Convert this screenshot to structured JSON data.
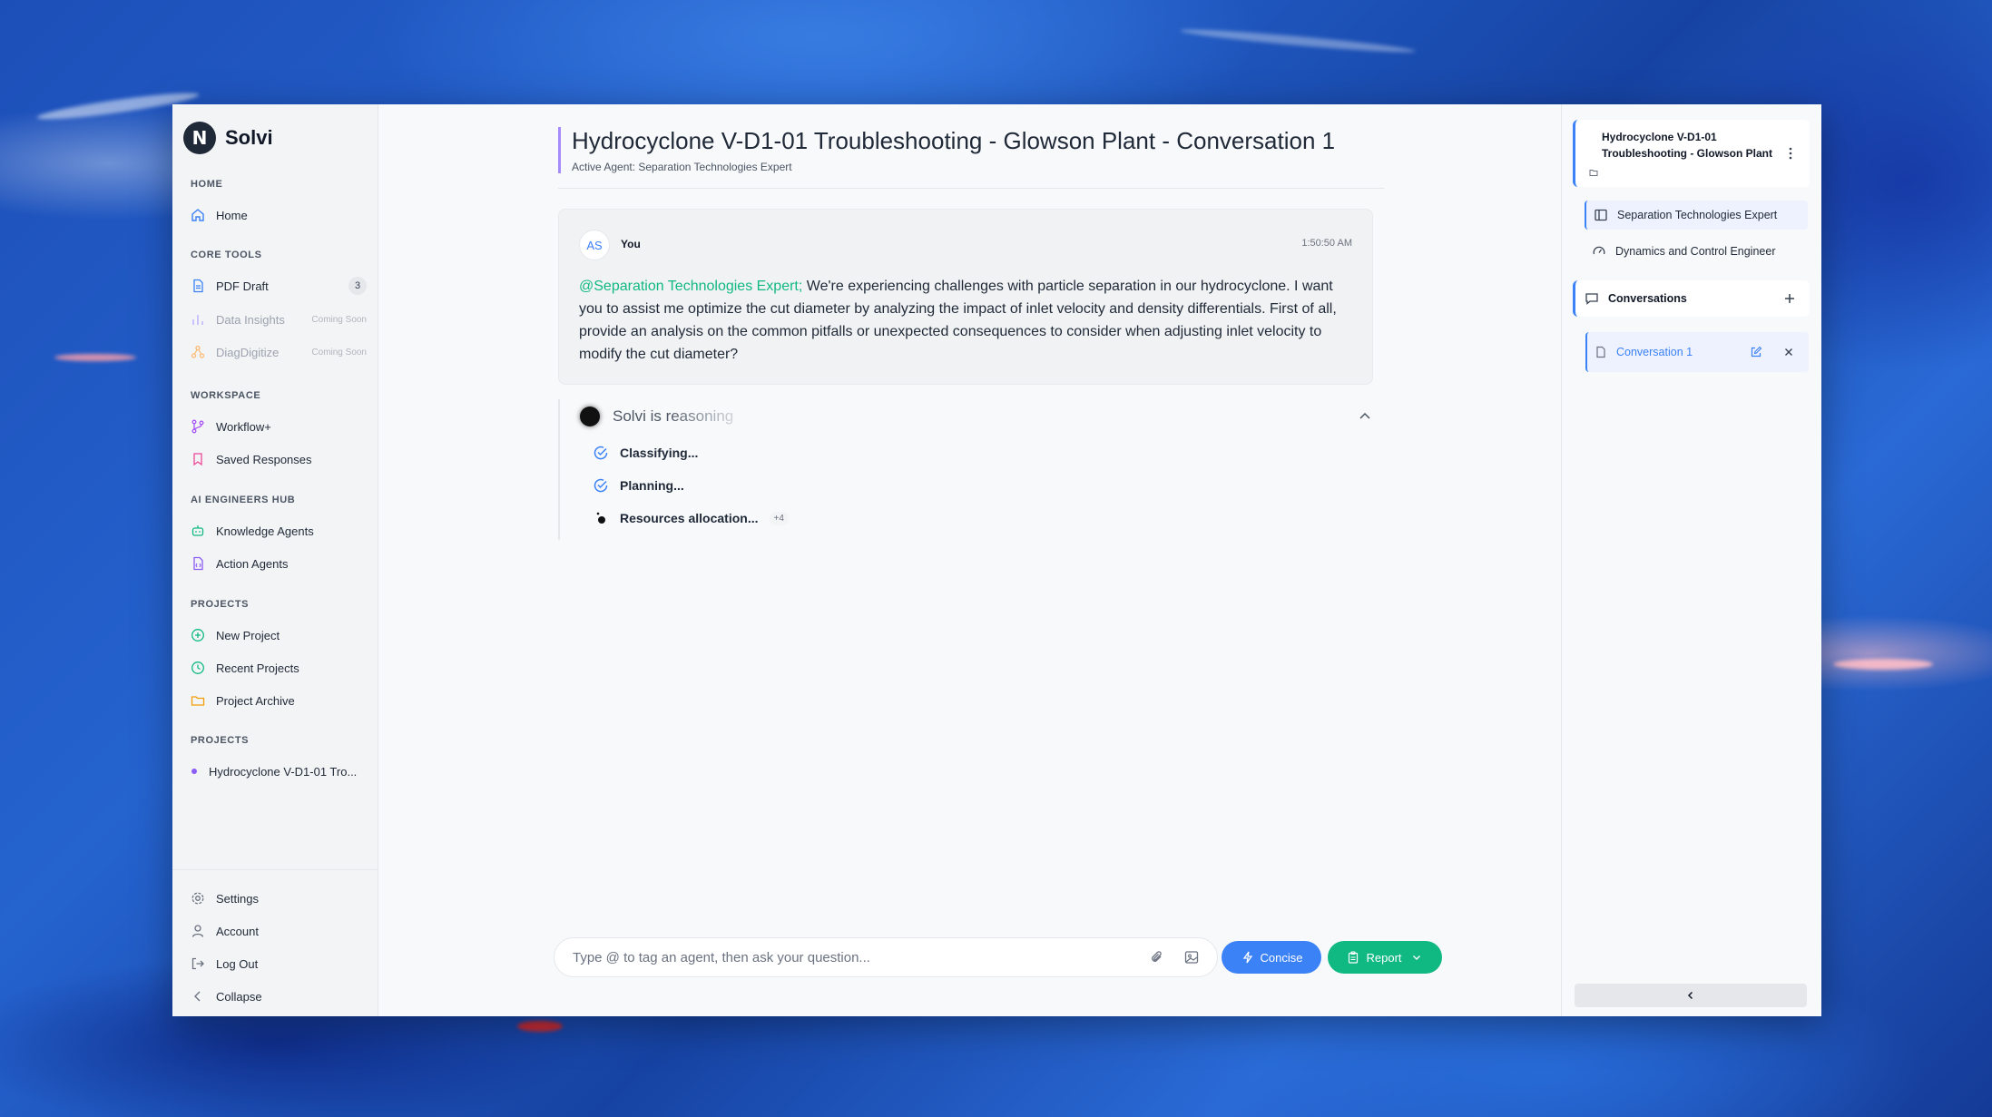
{
  "sidebar": {
    "brand": "Solvi",
    "brand_logo_letter": "N",
    "sections": {
      "home": "HOME",
      "core_tools": "CORE TOOLS",
      "workspace": "WORKSPACE",
      "ai_hub": "AI ENGINEERS HUB",
      "projects": "PROJECTS",
      "projects_list": "PROJECTS"
    },
    "items": {
      "home": "Home",
      "pdf_draft": "PDF Draft",
      "pdf_draft_count": "3",
      "data_insights": "Data Insights",
      "diagdigitize": "DiagDigitize",
      "coming_soon": "Coming Soon",
      "workflow": "Workflow+",
      "saved_responses": "Saved Responses",
      "knowledge_agents": "Knowledge Agents",
      "action_agents": "Action Agents",
      "new_project": "New Project",
      "recent_projects": "Recent Projects",
      "project_archive": "Project Archive",
      "project_entry": "Hydrocyclone V-D1-01 Tro..."
    },
    "bottom": {
      "settings": "Settings",
      "account": "Account",
      "logout": "Log Out",
      "collapse": "Collapse"
    }
  },
  "main": {
    "title": "Hydrocyclone V-D1-01 Troubleshooting - Glowson Plant - Conversation 1",
    "subtitle": "Active Agent: Separation Technologies Expert",
    "message": {
      "avatar": "AS",
      "sender": "You",
      "time": "1:50:50 AM",
      "mention": "@Separation Technologies Expert;",
      "body": " We're experiencing challenges with particle separation in our hydrocyclone. I want you to assist me optimize the cut diameter by analyzing the impact of inlet velocity and density differentials. First of all, provide an analysis on the common pitfalls or unexpected consequences to consider when adjusting inlet velocity to modify the cut diameter?"
    },
    "reasoning": {
      "title": "Solvi is reasoning",
      "steps": [
        "Classifying...",
        "Planning...",
        "Resources allocation..."
      ],
      "more": "+4"
    },
    "composer": {
      "placeholder": "Type @ to tag an agent, then ask your question...",
      "concise": "Concise",
      "report": "Report"
    }
  },
  "right_panel": {
    "project_title": "Hydrocyclone V-D1-01 Troubleshooting - Glowson Plant",
    "agents": [
      "Separation Technologies Expert",
      "Dynamics and Control Engineer"
    ],
    "conversations_label": "Conversations",
    "conversation_item": "Conversation 1"
  },
  "colors": {
    "accent_blue": "#3b82f6",
    "accent_green": "#10b981",
    "accent_purple": "#a78bfa"
  }
}
